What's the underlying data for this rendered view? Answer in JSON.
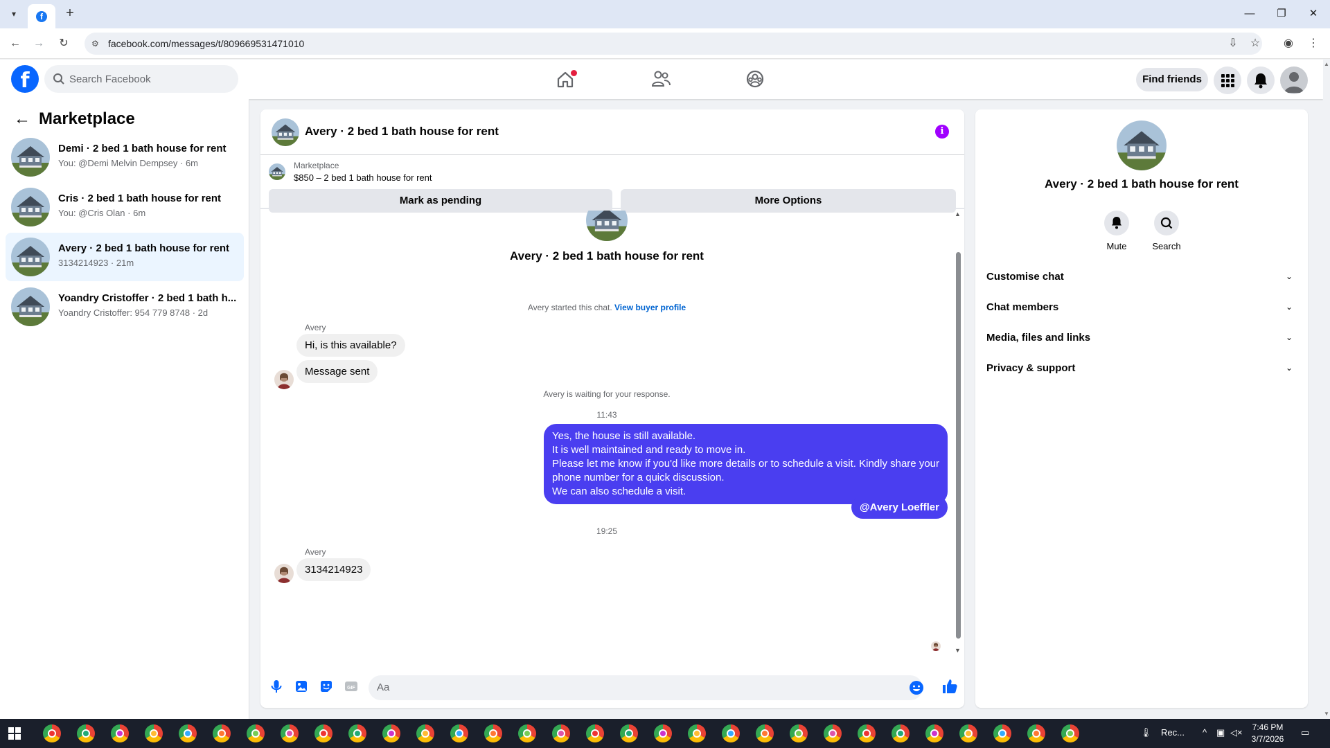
{
  "browser": {
    "url": "facebook.com/messages/t/809669531471010"
  },
  "fbnav": {
    "search_placeholder": "Search Facebook",
    "find_friends": "Find friends"
  },
  "sidebar": {
    "title": "Marketplace",
    "conversations": [
      {
        "name": "Demi · 2 bed 1 bath house for rent",
        "sub": "You: @Demi Melvin Dempsey · 6m"
      },
      {
        "name": "Cris · 2 bed 1 bath house for rent",
        "sub": "You: @Cris Olan · 6m"
      },
      {
        "name": "Avery · 2 bed 1 bath house for rent",
        "sub": "3134214923 · 21m"
      },
      {
        "name": "Yoandry Cristoffer · 2 bed 1 bath h...",
        "sub": "Yoandry Cristoffer: 954 779 8748 · 2d"
      }
    ]
  },
  "chat": {
    "header_title": "Avery · 2 bed 1 bath house for rent",
    "marketplace_label": "Marketplace",
    "listing": "$850 – 2 bed 1 bath house for rent",
    "mark_pending": "Mark as pending",
    "more_options": "More Options",
    "conv_title": "Avery · 2 bed 1 bath house for rent",
    "started_text": "Avery started this chat.",
    "view_buyer": "View buyer profile",
    "sender_name": "Avery",
    "msg1": "Hi, is this available?",
    "msg2": "Message sent",
    "waiting": "Avery is waiting for your response.",
    "time1": "11:43",
    "reply_lines": [
      "Yes, the house is still available.",
      "It is well maintained and ready to move in.",
      "Please let me know if you'd like more details or to schedule a visit. Kindly share your",
      "phone number for a quick discussion.",
      "We can also schedule a visit."
    ],
    "mention": "@Avery Loeffler",
    "time2": "19:25",
    "sender_name2": "Avery",
    "msg3": "3134214923",
    "composer_placeholder": "Aa"
  },
  "rightpane": {
    "title": "Avery · 2 bed 1 bath house for rent",
    "mute": "Mute",
    "search": "Search",
    "rows": [
      "Customise chat",
      "Chat members",
      "Media, files and links",
      "Privacy & support"
    ]
  },
  "taskbar": {
    "weather": "Rec...",
    "time": "7:46 PM",
    "date": "3/7/2026"
  },
  "colors": {
    "fb_blue": "#0866ff",
    "outgoing_bubble": "#4a3ef0",
    "info_purple": "#a000ff",
    "active_row": "#ebf5ff"
  }
}
